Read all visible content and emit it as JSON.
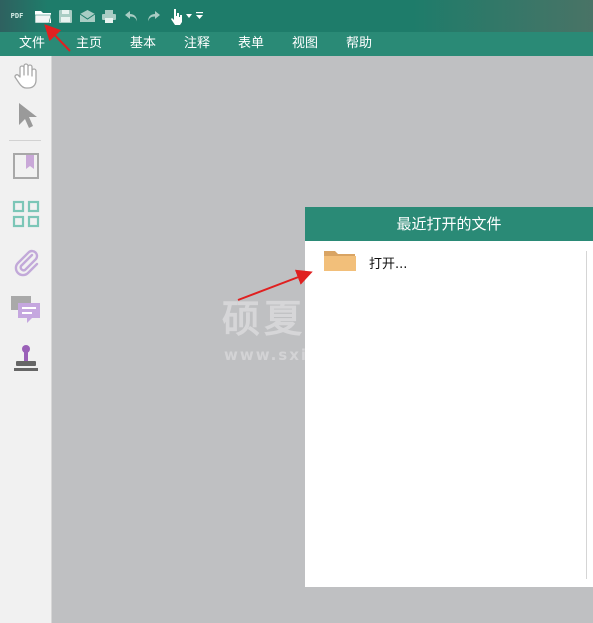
{
  "app": {
    "logo_text": "PDF",
    "accent_color": "#2a8a76",
    "annotation_color": "#e02020"
  },
  "quick_access": [
    {
      "icon": "open-folder-icon"
    },
    {
      "icon": "save-icon"
    },
    {
      "icon": "email-icon"
    },
    {
      "icon": "print-icon"
    },
    {
      "icon": "undo-icon"
    },
    {
      "icon": "redo-icon"
    },
    {
      "icon": "hand-pointer-icon"
    },
    {
      "icon": "customize-dropdown-icon"
    }
  ],
  "menu": {
    "file": "文件",
    "home": "主页",
    "basic": "基本",
    "annotate": "注释",
    "form": "表单",
    "view": "视图",
    "help": "帮助"
  },
  "sidebar": {
    "tools": [
      "hand-tool-icon",
      "select-arrow-icon",
      "bookmark-icon",
      "thumbnails-icon",
      "attachment-icon",
      "comments-icon",
      "stamp-icon"
    ]
  },
  "watermark": {
    "text": "硕夏",
    "url": "www.sxia"
  },
  "recent_panel": {
    "title": "最近打开的文件",
    "open_label": "打开..."
  }
}
